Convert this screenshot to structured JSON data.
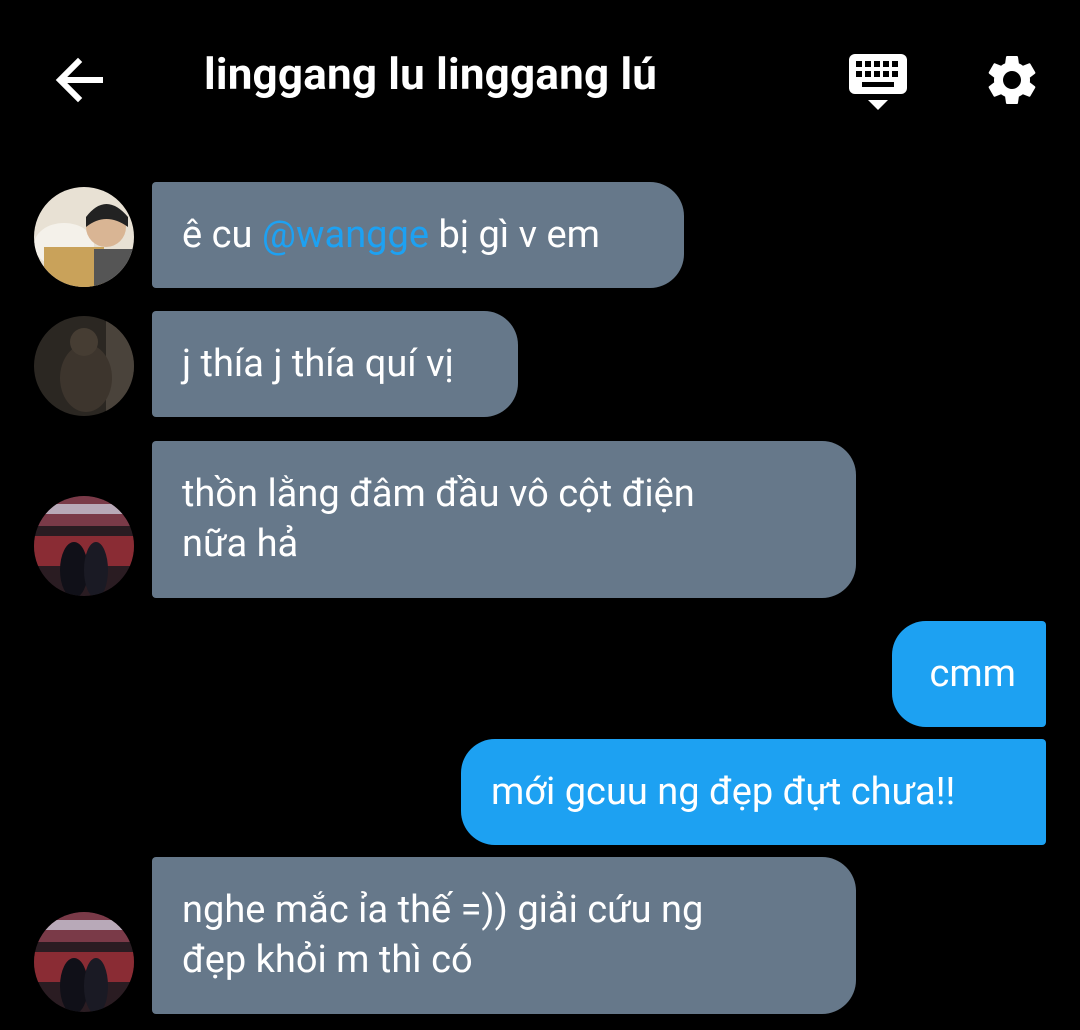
{
  "header": {
    "title": "linggang lu linggang lú",
    "back_icon": "arrow-left-icon",
    "keyboard_icon": "keyboard-icon",
    "settings_icon": "gear-icon"
  },
  "colors": {
    "background": "#000000",
    "incoming_bubble": "#66788a",
    "outgoing_bubble": "#1da1f2",
    "mention": "#1da1f2"
  },
  "messages": [
    {
      "direction": "incoming",
      "before": "ê cu ",
      "mention": "@wangge",
      "after": " bị gì v em"
    },
    {
      "direction": "incoming",
      "text": "j thía j thía quí vị"
    },
    {
      "direction": "incoming",
      "line1": "thồn lằng đâm đầu vô cột điện",
      "line2": "nữa hả"
    },
    {
      "direction": "outgoing",
      "text": "cmm"
    },
    {
      "direction": "outgoing",
      "text": "mới gcuu ng đẹp đựt chưa!!"
    },
    {
      "direction": "incoming",
      "line1": "nghe mắc ỉa thế =)) giải cứu ng",
      "line2": "đẹp khỏi m thì có"
    }
  ]
}
